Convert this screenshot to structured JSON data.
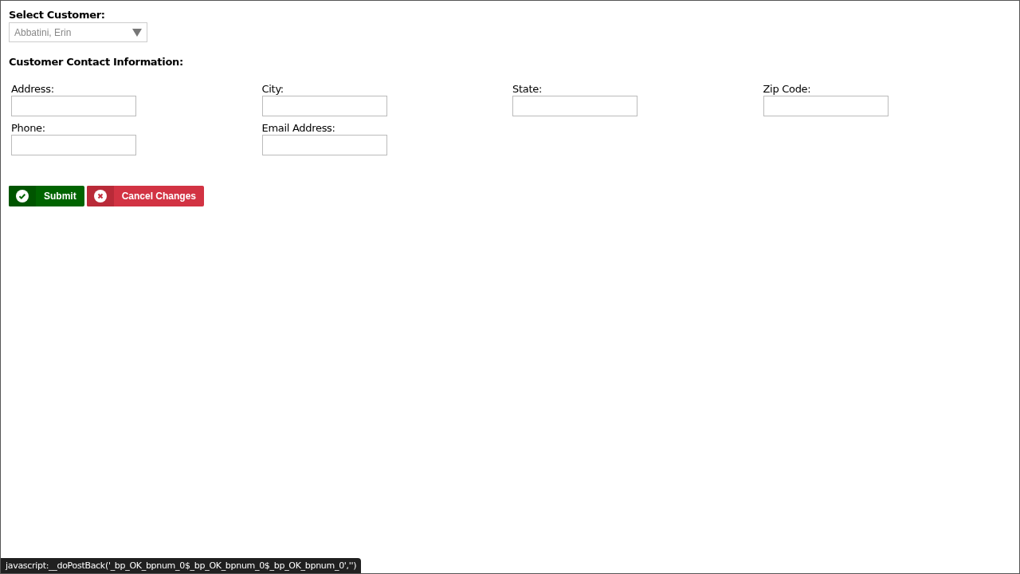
{
  "customer_select": {
    "label": "Select Customer:",
    "value": "Abbatini, Erin"
  },
  "contact_section": {
    "title": "Customer Contact Information:",
    "fields": [
      {
        "label": "Address:"
      },
      {
        "label": "City:"
      },
      {
        "label": "State:"
      },
      {
        "label": "Zip Code:"
      },
      {
        "label": "Phone:"
      },
      {
        "label": "Email Address:"
      }
    ]
  },
  "buttons": [
    {
      "kind": "submit",
      "label": "Submit"
    },
    {
      "kind": "cancel",
      "label": "Cancel Changes"
    }
  ],
  "status_bar": "javascript:__doPostBack('_bp_OK_bpnum_0$_bp_OK_bpnum_0$_bp_OK_bpnum_0','')"
}
